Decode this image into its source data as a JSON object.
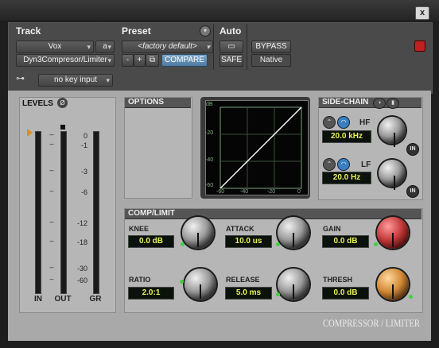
{
  "window": {
    "close_label": "x"
  },
  "track": {
    "title": "Track",
    "name": "Vox",
    "channel": "a",
    "insert": "Dyn3Compresor/Limiter"
  },
  "preset": {
    "title": "Preset",
    "name": "<factory default>",
    "minus": "-",
    "plus": "+",
    "compare_label": "COMPARE"
  },
  "auto": {
    "title": "Auto",
    "safe_label": "SAFE"
  },
  "plugin": {
    "bypass_label": "BYPASS",
    "format_label": "Native"
  },
  "key": {
    "input_label": "no key input"
  },
  "levels": {
    "title": "LEVELS",
    "scale": [
      "0",
      "-1",
      "-3",
      "-6",
      "-12",
      "-18",
      "-30",
      "-60"
    ],
    "labels": {
      "in": "IN",
      "out": "OUT",
      "gr": "GR"
    }
  },
  "options": {
    "title": "OPTIONS"
  },
  "graph": {
    "y_ticks": [
      "dB",
      "-20",
      "-40",
      "-60"
    ],
    "x_ticks": [
      "-60",
      "-40",
      "-20",
      "0"
    ]
  },
  "sidechain": {
    "title": "SIDE-CHAIN",
    "hf_label": "HF",
    "hf_value": "20.0 kHz",
    "lf_label": "LF",
    "lf_value": "20.0 Hz",
    "in_label": "IN"
  },
  "comp": {
    "title": "COMP/LIMIT",
    "knee": {
      "label": "KNEE",
      "value": "0.0 dB"
    },
    "attack": {
      "label": "ATTACK",
      "value": "10.0 us"
    },
    "gain": {
      "label": "GAIN",
      "value": "0.0 dB"
    },
    "ratio": {
      "label": "RATIO",
      "value": "2.0:1"
    },
    "release": {
      "label": "RELEASE",
      "value": "5.0 ms"
    },
    "thresh": {
      "label": "THRESH",
      "value": "0.0 dB"
    }
  },
  "brand": {
    "name": "COMPRESSOR / LIMITER"
  },
  "colors": {
    "lcd_text": "#eaf25a",
    "led": "#3cd33c",
    "gain_knob": "#c43a3a",
    "thresh_knob": "#d38a35",
    "compare": "#6a92b8"
  }
}
